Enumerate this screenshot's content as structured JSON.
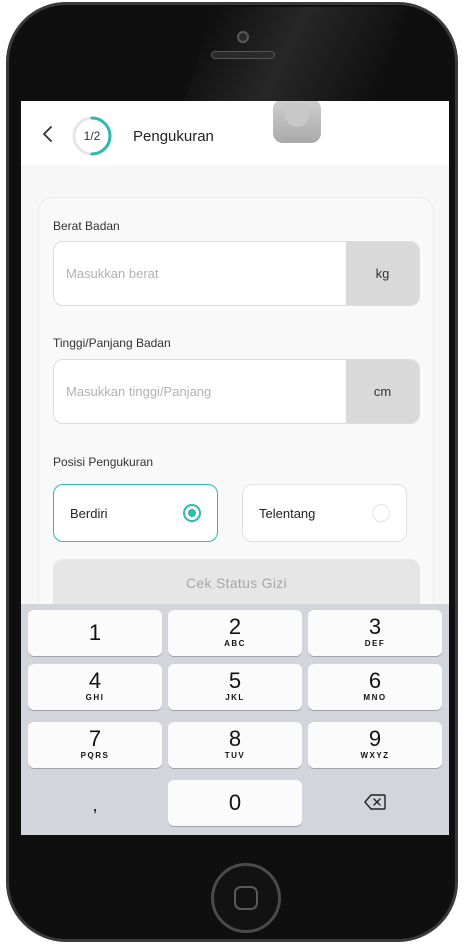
{
  "header": {
    "back_icon": "chevron-left-icon",
    "step": "1/2",
    "step_progress": 0.5,
    "title": "Pengukuran"
  },
  "form": {
    "weight_label": "Berat Badan",
    "weight_placeholder": "Masukkan berat",
    "weight_unit": "kg",
    "height_label": "Tinggi/Panjang Badan",
    "height_placeholder": "Masukkan tinggi/Panjang",
    "height_unit": "cm",
    "position_label": "Posisi Pengukuran",
    "options": [
      {
        "label": "Berdiri",
        "selected": true
      },
      {
        "label": "Telentang",
        "selected": false
      }
    ],
    "submit_label": "Cek Status Gizi"
  },
  "keypad": {
    "keys": [
      {
        "digit": "1",
        "letters": ""
      },
      {
        "digit": "2",
        "letters": "ABC"
      },
      {
        "digit": "3",
        "letters": "DEF"
      },
      {
        "digit": "4",
        "letters": "GHI"
      },
      {
        "digit": "5",
        "letters": "JKL"
      },
      {
        "digit": "6",
        "letters": "MNO"
      },
      {
        "digit": "7",
        "letters": "PQRS"
      },
      {
        "digit": "8",
        "letters": "TUV"
      },
      {
        "digit": "9",
        "letters": "WXYZ"
      }
    ],
    "comma": ",",
    "zero": "0",
    "delete_icon": "backspace-icon"
  },
  "colors": {
    "accent": "#2fb9ae",
    "keyboard_bg": "#d2d5db",
    "unit_bg": "#d9d9d9"
  }
}
